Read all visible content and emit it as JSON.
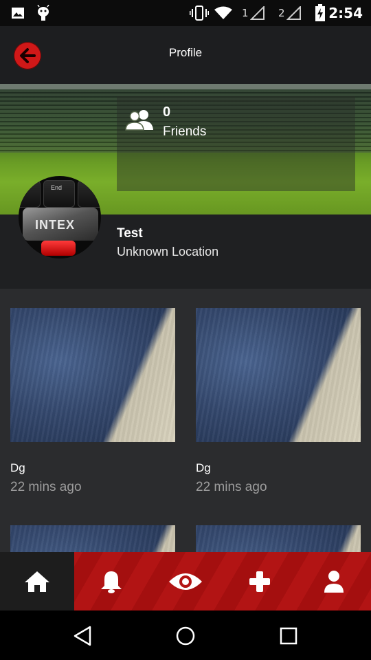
{
  "status_bar": {
    "sim1": "1",
    "sim2": "2",
    "time": "2:54",
    "icons": [
      "image-notification-icon",
      "android-debug-icon",
      "vibrate-icon",
      "wifi-icon",
      "signal-icon",
      "battery-charging-icon"
    ]
  },
  "toolbar": {
    "title": "Profile",
    "back_icon": "arrow-left-icon",
    "accent": "#d01818"
  },
  "cover": {
    "friends_count": "0",
    "friends_label": "Friends",
    "friends_icon": "users-icon"
  },
  "profile": {
    "name": "Test",
    "location": "Unknown Location",
    "avatar_text_end": "End",
    "avatar_brand": "INTEX"
  },
  "posts": [
    {
      "title": "Dg",
      "time": "22 mins ago"
    },
    {
      "title": "Dg",
      "time": "22 mins ago"
    },
    {
      "title": "",
      "time": ""
    },
    {
      "title": "",
      "time": ""
    }
  ],
  "tabs": [
    {
      "name": "home",
      "icon": "home-icon",
      "active": true
    },
    {
      "name": "notifications",
      "icon": "bell-icon",
      "active": false
    },
    {
      "name": "watch",
      "icon": "eye-icon",
      "active": false
    },
    {
      "name": "add",
      "icon": "plus-icon",
      "active": false
    },
    {
      "name": "profile",
      "icon": "user-icon",
      "active": false
    }
  ],
  "nav": [
    "back-icon",
    "home-circle-icon",
    "recents-icon"
  ],
  "colors": {
    "tabbar_red": "#b21414",
    "background": "#2b2c2e",
    "muted_text": "#9c9c9c"
  }
}
